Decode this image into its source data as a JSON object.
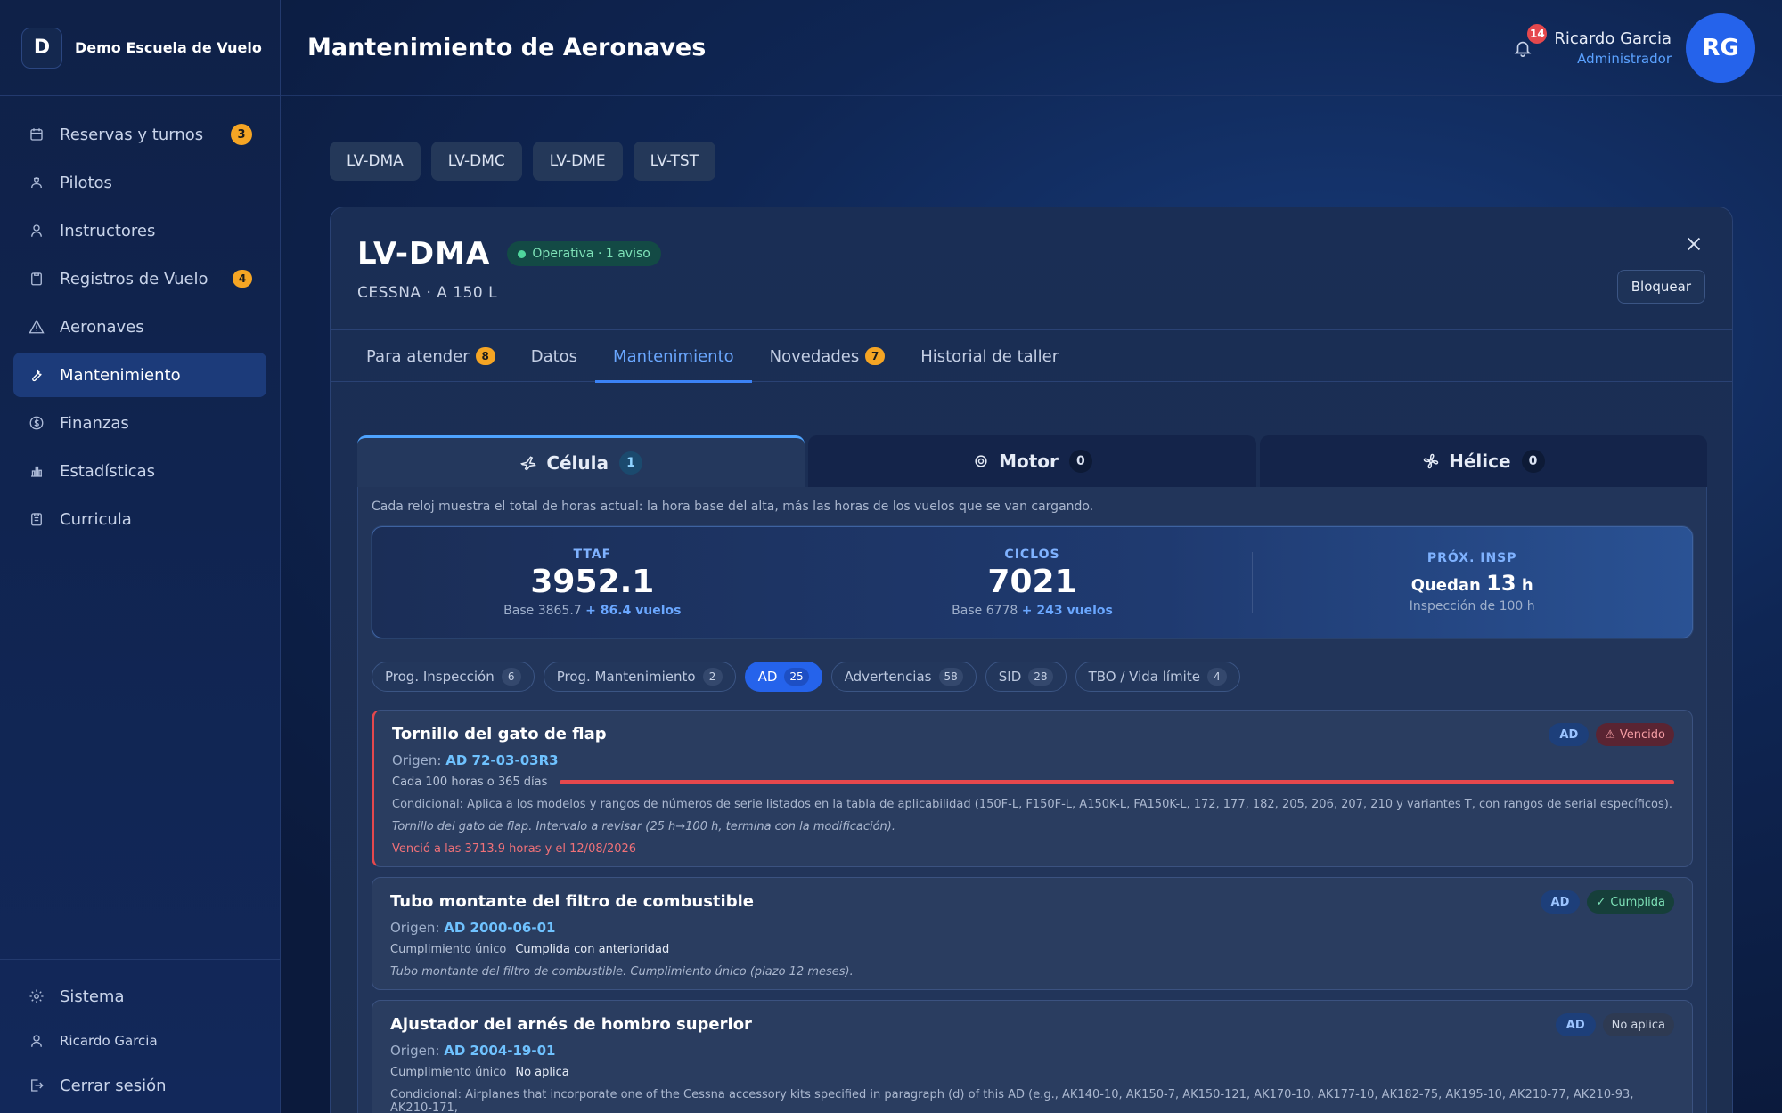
{
  "app": {
    "brand_initial": "D",
    "brand_name": "Demo Escuela de Vuelo",
    "page_title": "Mantenimiento de Aeronaves"
  },
  "sidebar": {
    "items": [
      {
        "label": "Reservas y turnos",
        "icon": "calendar-icon",
        "badge": "3"
      },
      {
        "label": "Pilotos",
        "icon": "pilot-icon",
        "badge": ""
      },
      {
        "label": "Instructores",
        "icon": "user-icon",
        "badge": ""
      },
      {
        "label": "Registros de Vuelo",
        "icon": "clipboard-icon",
        "badge": "4"
      },
      {
        "label": "Aeronaves",
        "icon": "warning-icon",
        "badge": ""
      },
      {
        "label": "Mantenimiento",
        "icon": "wrench-icon",
        "badge": ""
      },
      {
        "label": "Finanzas",
        "icon": "dollar-icon",
        "badge": ""
      },
      {
        "label": "Estadísticas",
        "icon": "bar-chart-icon",
        "badge": ""
      },
      {
        "label": "Curricula",
        "icon": "clipboard-list-icon",
        "badge": ""
      }
    ],
    "bottom": {
      "system": "Sistema",
      "user": "Ricardo Garcia",
      "logout": "Cerrar sesión"
    }
  },
  "header": {
    "notifications": "14",
    "user_name": "Ricardo Garcia",
    "user_role": "Administrador",
    "avatar_initials": "RG"
  },
  "aircraft_tabs": [
    "LV-DMA",
    "LV-DMC",
    "LV-DME",
    "LV-TST"
  ],
  "aircraft": {
    "registration": "LV-DMA",
    "status": "Operativa · 1 aviso",
    "model": "CESSNA · A 150 L",
    "block_label": "Bloquear"
  },
  "sub_tabs": {
    "t1": {
      "label": "Para atender",
      "badge": "8"
    },
    "t2": {
      "label": "Datos"
    },
    "t3": {
      "label": "Mantenimiento"
    },
    "t4": {
      "label": "Novedades",
      "badge": "7"
    },
    "t5": {
      "label": "Historial de taller"
    }
  },
  "component_tabs": {
    "c1": {
      "label": "Célula",
      "count": "1"
    },
    "c2": {
      "label": "Motor",
      "count": "0"
    },
    "c3": {
      "label": "Hélice",
      "count": "0"
    }
  },
  "panel_note": "Cada reloj muestra el total de horas actual: la hora base del alta, más las horas de los vuelos que se van cargando.",
  "stats": {
    "ttaf": {
      "label": "TTAF",
      "value": "3952.1",
      "base": "Base 3865.7",
      "added": "+ 86.4 vuelos"
    },
    "ciclos": {
      "label": "CICLOS",
      "value": "7021",
      "base": "Base 6778",
      "added": "+ 243 vuelos"
    },
    "prox": {
      "label": "PRÓX. INSP",
      "prefix": "Quedan",
      "value": "13",
      "unit": "h",
      "sub": "Inspección de 100 h"
    }
  },
  "filters": {
    "f1": {
      "label": "Prog. Inspección",
      "count": "6"
    },
    "f2": {
      "label": "Prog. Mantenimiento",
      "count": "2"
    },
    "f3": {
      "label": "AD",
      "count": "25"
    },
    "f4": {
      "label": "Advertencias",
      "count": "58"
    },
    "f5": {
      "label": "SID",
      "count": "28"
    },
    "f6": {
      "label": "TBO / Vida límite",
      "count": "4"
    }
  },
  "items": {
    "i1": {
      "title": "Tornillo del gato de flap",
      "origin_prefix": "Origen:",
      "origin": "AD 72-03-03R3",
      "interval": "Cada 100 horas o 365 días",
      "progress": 1.0,
      "conditional": "Condicional: Aplica a los modelos y rangos de números de serie listados en la tabla de aplicabilidad (150F-L, F150F-L, A150K-L, FA150K-L, 172, 177, 182, 205, 206, 207, 210 y variantes T, con rangos de serial específicos).",
      "desc": "Tornillo del gato de flap. Intervalo a revisar (25 h→100 h, termina con la modificación).",
      "overdue": "Venció a las 3713.9 horas y el 12/08/2026",
      "tag": "AD",
      "status": "Vencido"
    },
    "i2": {
      "title": "Tubo montante del filtro de combustible",
      "origin_prefix": "Origen:",
      "origin": "AD 2000-06-01",
      "compliance": "Cumplimiento único",
      "compliance_value": "Cumplida con anterioridad",
      "desc": "Tubo montante del filtro de combustible. Cumplimiento único (plazo 12 meses).",
      "tag": "AD",
      "status": "Cumplida"
    },
    "i3": {
      "title": "Ajustador del arnés de hombro superior",
      "origin_prefix": "Origen:",
      "origin": "AD 2004-19-01",
      "compliance": "Cumplimiento único",
      "compliance_value": "No aplica",
      "conditional": "Condicional: Airplanes that incorporate one of the Cessna accessory kits specified in paragraph (d) of this AD (e.g., AK140-10, AK150-7, AK150-121, AK170-10, AK177-10, AK182-75, AK195-10, AK210-77, AK210-93, AK210-171,",
      "tag": "AD",
      "status": "No aplica"
    }
  },
  "colors": {
    "accent": "#3b82f6",
    "danger": "#e5484d",
    "success": "#4fd69c",
    "badge": "#f5a524"
  }
}
